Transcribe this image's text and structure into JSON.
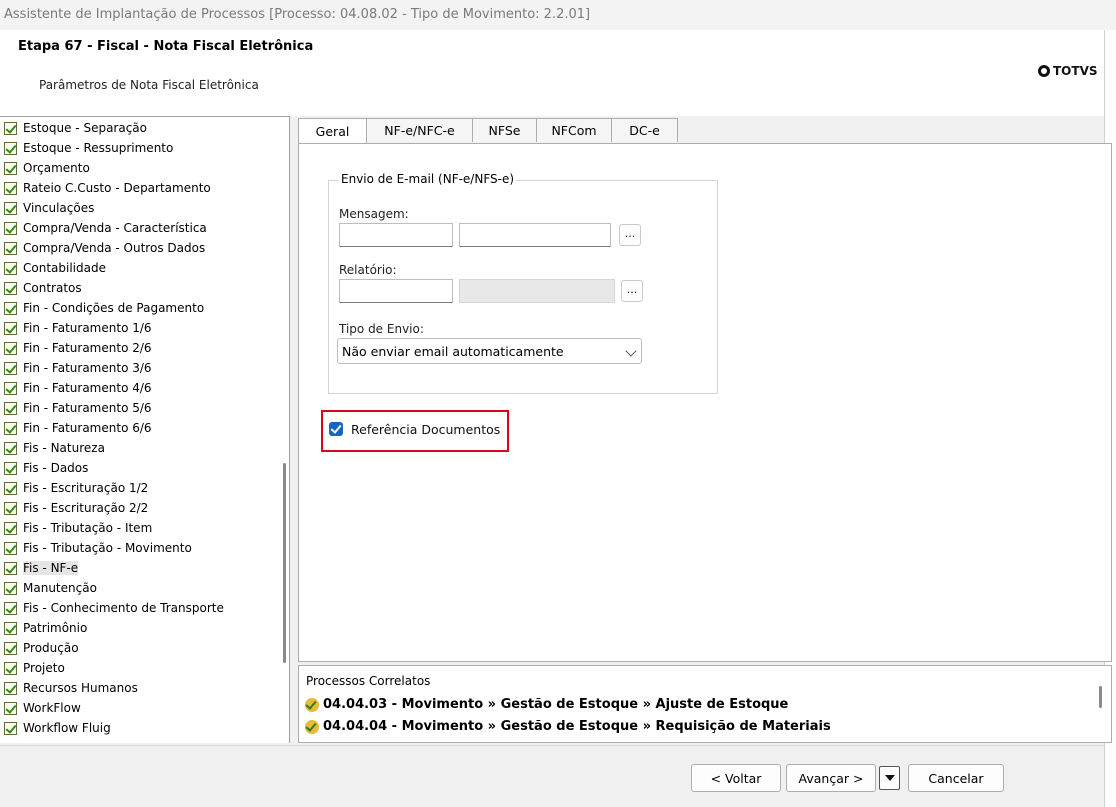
{
  "window": {
    "title": "Assistente de Implantação de Processos [Processo: 04.08.02 - Tipo de Movimento: 2.2.01]"
  },
  "header": {
    "title": "Etapa 67 - Fiscal - Nota Fiscal Eletrônica",
    "subtitle": "Parâmetros de Nota Fiscal Eletrônica",
    "logo": "TOTVS"
  },
  "tree": {
    "items": [
      {
        "label": "Estoque - Separação"
      },
      {
        "label": "Estoque - Ressuprimento"
      },
      {
        "label": "Orçamento"
      },
      {
        "label": "Rateio C.Custo - Departamento"
      },
      {
        "label": "Vinculações"
      },
      {
        "label": "Compra/Venda - Característica"
      },
      {
        "label": "Compra/Venda - Outros Dados"
      },
      {
        "label": "Contabilidade"
      },
      {
        "label": "Contratos"
      },
      {
        "label": "Fin - Condições de Pagamento"
      },
      {
        "label": "Fin - Faturamento 1/6"
      },
      {
        "label": "Fin - Faturamento 2/6"
      },
      {
        "label": "Fin - Faturamento 3/6"
      },
      {
        "label": "Fin - Faturamento 4/6"
      },
      {
        "label": "Fin - Faturamento 5/6"
      },
      {
        "label": "Fin - Faturamento 6/6"
      },
      {
        "label": "Fis - Natureza"
      },
      {
        "label": "Fis - Dados"
      },
      {
        "label": "Fis - Escrituração 1/2"
      },
      {
        "label": "Fis - Escrituração 2/2"
      },
      {
        "label": "Fis - Tributação - Item"
      },
      {
        "label": "Fis - Tributação - Movimento"
      },
      {
        "label": "Fis - NF-e",
        "selected": true
      },
      {
        "label": "Manutenção"
      },
      {
        "label": "Fis - Conhecimento de Transporte"
      },
      {
        "label": "Patrimônio"
      },
      {
        "label": "Produção"
      },
      {
        "label": "Projeto"
      },
      {
        "label": "Recursos Humanos"
      },
      {
        "label": "WorkFlow"
      },
      {
        "label": "Workflow Fluig"
      }
    ]
  },
  "tabs": [
    {
      "label": "Geral",
      "active": true
    },
    {
      "label": "NF-e/NFC-e"
    },
    {
      "label": "NFSe"
    },
    {
      "label": "NFCom"
    },
    {
      "label": "DC-e"
    }
  ],
  "form": {
    "group_title": "Envio de E-mail (NF-e/NFS-e)",
    "mensagem_label": "Mensagem:",
    "relatorio_label": "Relatório:",
    "browse_label": "...",
    "tipo_envio_label": "Tipo de Envio:",
    "tipo_envio_value": "Não enviar email automaticamente",
    "referencia_label": "Referência Documentos",
    "referencia_checked": true
  },
  "related": {
    "title": "Processos Correlatos",
    "items": [
      {
        "label": "04.04.03 - Movimento » Gestão de Estoque » Ajuste de Estoque"
      },
      {
        "label": "04.04.04 - Movimento » Gestão de Estoque » Requisição de Materiais"
      }
    ]
  },
  "footer": {
    "back_label": "< Voltar",
    "next_label": "Avançar >",
    "cancel_label": "Cancelar"
  },
  "colors": {
    "highlight": "#e0001b",
    "checkbox": "#1565c0"
  }
}
